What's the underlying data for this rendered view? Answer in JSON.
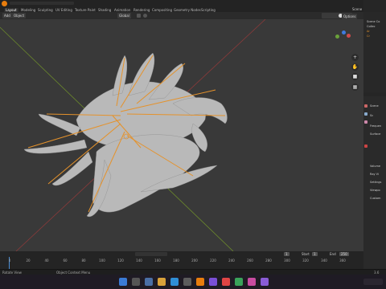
{
  "workspaces": [
    "Layout",
    "Modeling",
    "Sculpting",
    "UV Editing",
    "Texture Paint",
    "Shading",
    "Animation",
    "Rendering",
    "Compositing",
    "Geometry Nodes",
    "Scripting"
  ],
  "header": {
    "mode_menu": "Add",
    "object_menu": "Object",
    "orientation": "Global",
    "options": "Options",
    "scene": "Scene"
  },
  "outliner": {
    "scene_collection": "Scene Co",
    "collection": "Collec",
    "item1": "Ar",
    "item2": "Cr"
  },
  "properties": {
    "scene_label": "Scene",
    "panel_label": "Sc",
    "rows": [
      "Frequen",
      "Surface",
      "Volume",
      "Ray Vi",
      "Settings",
      "Viewpo",
      "Custom"
    ]
  },
  "timeline": {
    "frame_ticks": [
      "0",
      "20",
      "40",
      "60",
      "80",
      "100",
      "120",
      "140",
      "160",
      "180",
      "200",
      "220",
      "240",
      "260",
      "280",
      "300",
      "320",
      "340",
      "360"
    ],
    "top_marks": [
      "80",
      "70",
      "60",
      "50",
      "40",
      "30",
      "20",
      "10",
      "0"
    ],
    "current_frame": "1",
    "start_label": "Start",
    "start_value": "1",
    "end_label": "End",
    "end_value": "250"
  },
  "statusbar": {
    "left": "Rotate View",
    "mid": "Object Context Menu",
    "right": "3.6"
  },
  "colors": {
    "viewport_bg": "#393939",
    "bone": "#e5922b",
    "mesh": "#b9b9b9",
    "axis_x": "#8a3a3a",
    "axis_y": "#6c8a2c"
  }
}
